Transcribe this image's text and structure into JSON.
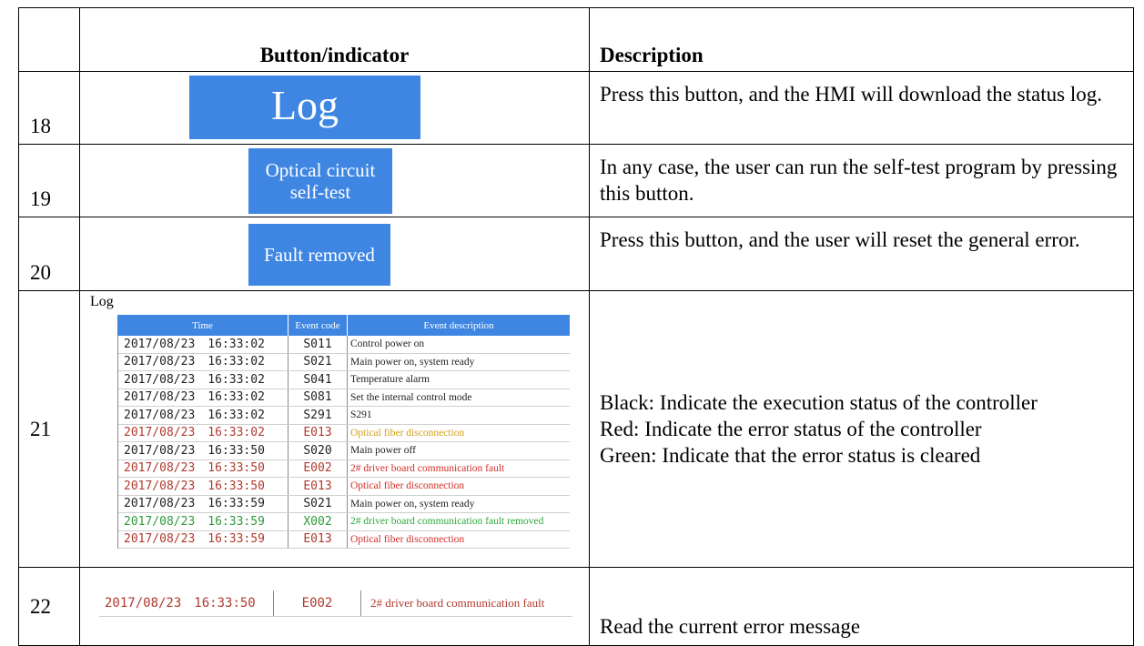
{
  "header": {
    "col_number": "",
    "col_button": "Button/indicator",
    "col_description": "Description"
  },
  "rows": {
    "r18": {
      "number": "18",
      "button_label": "Log",
      "description": "Press this button, and the HMI will download the status log."
    },
    "r19": {
      "number": "19",
      "button_line1": "Optical circuit",
      "button_line2": "self-test",
      "description": "In any case, the user can run the self-test program by pressing this button."
    },
    "r20": {
      "number": "20",
      "button_label": "Fault removed",
      "description": "Press this button, and the user will reset the general error."
    },
    "r21": {
      "number": "21",
      "log_title": "Log",
      "log_headers": {
        "time": "Time",
        "code": "Event code",
        "desc": "Event description"
      },
      "desc_line1": "Black: Indicate the execution status of the controller",
      "desc_line2": "Red: Indicate the error status of the controller",
      "desc_line3": "Green: Indicate that the error status is cleared"
    },
    "r22": {
      "number": "22",
      "date": "2017/08/23",
      "time": "16:33:50",
      "code": "E002",
      "event": "2# driver board communication fault",
      "description": "Read the current error message"
    }
  },
  "log_entries": [
    {
      "date": "2017/08/23",
      "time": "16:33:02",
      "code": "S011",
      "desc": "Control power on",
      "color": "#222222",
      "desc_color": "#222222"
    },
    {
      "date": "2017/08/23",
      "time": "16:33:02",
      "code": "S021",
      "desc": "Main power on, system ready",
      "color": "#222222",
      "desc_color": "#222222"
    },
    {
      "date": "2017/08/23",
      "time": "16:33:02",
      "code": "S041",
      "desc": "Temperature alarm",
      "color": "#222222",
      "desc_color": "#222222"
    },
    {
      "date": "2017/08/23",
      "time": "16:33:02",
      "code": "S081",
      "desc": "Set the internal control mode",
      "color": "#222222",
      "desc_color": "#222222"
    },
    {
      "date": "2017/08/23",
      "time": "16:33:02",
      "code": "S291",
      "desc": "S291",
      "color": "#222222",
      "desc_color": "#222222"
    },
    {
      "date": "2017/08/23",
      "time": "16:33:02",
      "code": "E013",
      "desc": "Optical fiber disconnection",
      "color": "#b03a2e",
      "desc_color": "#d4a017"
    },
    {
      "date": "2017/08/23",
      "time": "16:33:50",
      "code": "S020",
      "desc": "Main power off",
      "color": "#222222",
      "desc_color": "#222222"
    },
    {
      "date": "2017/08/23",
      "time": "16:33:50",
      "code": "E002",
      "desc": "2# driver board communication fault",
      "color": "#b03a2e",
      "desc_color": "#d0302a"
    },
    {
      "date": "2017/08/23",
      "time": "16:33:50",
      "code": "E013",
      "desc": "Optical fiber disconnection",
      "color": "#b03a2e",
      "desc_color": "#d0302a"
    },
    {
      "date": "2017/08/23",
      "time": "16:33:59",
      "code": "S021",
      "desc": "Main power on, system ready",
      "color": "#222222",
      "desc_color": "#222222"
    },
    {
      "date": "2017/08/23",
      "time": "16:33:59",
      "code": "X002",
      "desc": "2# driver board communication fault removed",
      "color": "#2e9a3a",
      "desc_color": "#2eaa3a"
    },
    {
      "date": "2017/08/23",
      "time": "16:33:59",
      "code": "E013",
      "desc": "Optical fiber disconnection",
      "color": "#b03a2e",
      "desc_color": "#d0302a"
    }
  ],
  "colors": {
    "button_blue": "#3f86e2",
    "error_red": "#b03a2e",
    "cleared_green": "#2e9a3a"
  }
}
